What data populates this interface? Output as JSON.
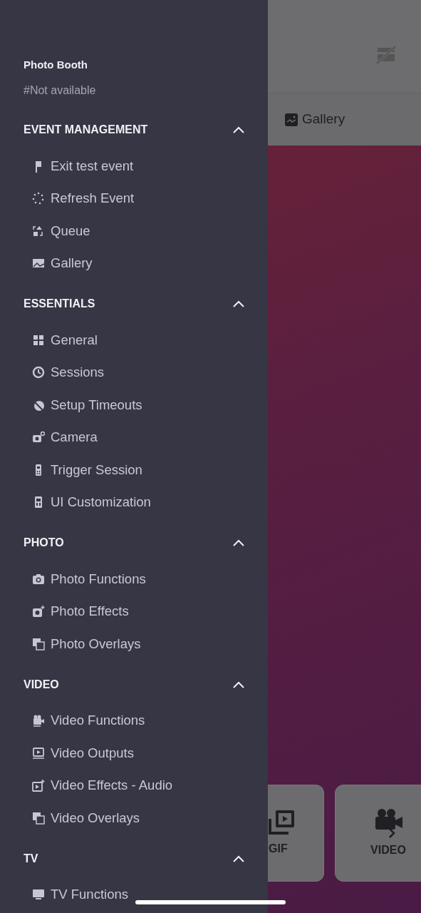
{
  "drawer": {
    "title": "Photo Booth",
    "subtitle": "#Not available",
    "sections": [
      {
        "heading": "EVENT MANAGEMENT",
        "expanded": true,
        "items": [
          "Exit test event",
          "Refresh Event",
          "Queue",
          "Gallery"
        ]
      },
      {
        "heading": "ESSENTIALS",
        "expanded": true,
        "items": [
          "General",
          "Sessions",
          "Setup Timeouts",
          "Camera",
          "Trigger Session",
          "UI Customization"
        ]
      },
      {
        "heading": "PHOTO",
        "expanded": true,
        "items": [
          "Photo Functions",
          "Photo Effects",
          "Photo Overlays"
        ]
      },
      {
        "heading": "VIDEO",
        "expanded": true,
        "items": [
          "Video Functions",
          "Video Outputs",
          "Video Effects - Audio",
          "Video Overlays"
        ]
      },
      {
        "heading": "TV",
        "expanded": true,
        "items": [
          "TV Functions"
        ]
      }
    ]
  },
  "background_screen": {
    "tab": "Gallery",
    "cards": [
      {
        "label": "GIF"
      },
      {
        "label": "VIDEO"
      }
    ]
  }
}
